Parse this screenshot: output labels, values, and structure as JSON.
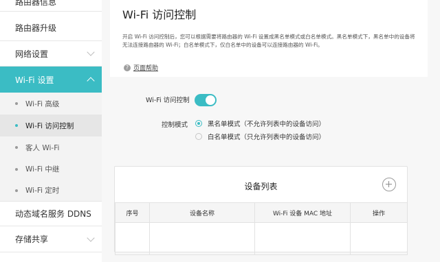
{
  "sidebar": {
    "items": [
      {
        "label": "路由器信息"
      },
      {
        "label": "路由器升级"
      },
      {
        "label": "网络设置"
      },
      {
        "label": "Wi-Fi 设置"
      },
      {
        "label": "Wi-Fi 高级"
      },
      {
        "label": "Wi-Fi 访问控制"
      },
      {
        "label": "客人 Wi-Fi"
      },
      {
        "label": "Wi-Fi 中继"
      },
      {
        "label": "Wi-Fi 定时"
      },
      {
        "label": "动态域名服务 DDNS"
      },
      {
        "label": "存储共享"
      }
    ]
  },
  "header": {
    "title": "Wi-Fi 访问控制",
    "description": "开启 Wi-Fi 访问控制后，您可以根据需要将路由器的 Wi-Fi 设置成黑名单模式或白名单模式。黑名单模式下，黑名单中的设备将无法连接路由器的 Wi-Fi；白名单模式下，仅白名单中的设备可以连接路由器的 Wi-Fi。",
    "help_icon": "?",
    "help_label": "页面帮助"
  },
  "settings": {
    "access_control_label": "Wi-Fi 访问控制",
    "access_control_enabled": true,
    "mode_label": "控制模式",
    "modes": [
      {
        "label": "黑名单模式（不允许列表中的设备访问）",
        "selected": true
      },
      {
        "label": "白名单模式（只允许列表中的设备访问）",
        "selected": false
      }
    ]
  },
  "device_list": {
    "title": "设备列表",
    "columns": [
      "序号",
      "设备名称",
      "Wi-Fi 设备 MAC 地址",
      "操作"
    ],
    "rows": []
  },
  "colors": {
    "accent": "#3bbcc4"
  }
}
